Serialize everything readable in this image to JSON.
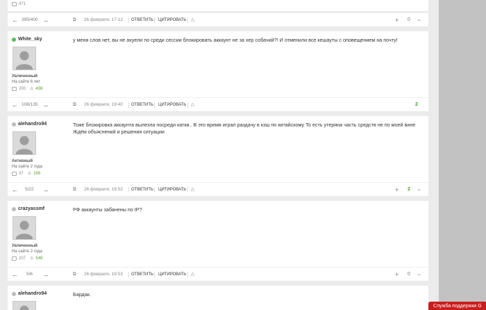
{
  "top_post": {
    "likes_count": "471",
    "page": "395/400",
    "date": "26 февраля, 17:12",
    "reply_label": "ОТВЕТИТЬ",
    "quote_label": "ЦИТИРОВАТЬ",
    "rating": "0"
  },
  "posts": [
    {
      "username": "White_sky",
      "status_color": "#5cb85c",
      "rank": "Увлеченный",
      "tenure": "На сайте 6 лет",
      "messages": "200",
      "likes": "436",
      "text": "у меня слов нет, вы не ахуели по среди сессии блокировать аккаунт не за хер собачий?! И отменили все кешауты с оповещением на почту!",
      "page": "108/135",
      "date": "26 февраля, 19:40",
      "reply_label": "ОТВЕТИТЬ",
      "quote_label": "ЦИТИРОВАТЬ",
      "rating": "2"
    },
    {
      "username": "alehandro94",
      "status_color": "#bbbbbb",
      "rank": "Активный",
      "tenure": "На сайте 2 года",
      "messages": "37",
      "likes": "199",
      "text": "Тоже блокировка аккаунта вылезла посреди катки.. В это время играл раздачу в кэш по китайскому То есть утеряна часть средств не по моей вине Ждём объяснений и решения ситуации",
      "page": "5/22",
      "date": "26 февраля, 19:52",
      "reply_label": "ОТВЕТИТЬ",
      "quote_label": "ЦИТИРОВАТЬ",
      "rating": "2"
    },
    {
      "username": "crazyassmf",
      "status_color": "#bbbbbb",
      "rank": "Увлеченный",
      "tenure": "На сайте 2 года",
      "messages": "207",
      "likes": "548",
      "text": "РФ аккаунты забанены по IP?",
      "page": "5/6",
      "date": "26 февраля, 19:53",
      "reply_label": "ОТВЕТИТЬ",
      "quote_label": "ЦИТИРОВАТЬ",
      "rating": "0"
    },
    {
      "username": "alehandro94",
      "status_color": "#bbbbbb",
      "text": "Бардак."
    }
  ],
  "widget": {
    "label": "Служба поддержки G"
  }
}
